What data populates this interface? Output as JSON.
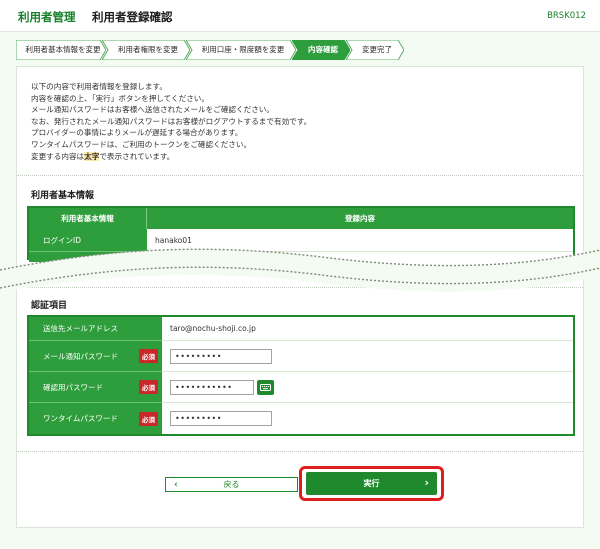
{
  "header": {
    "title": "利用者管理",
    "subtitle": "利用者登録確認",
    "screen_code": "BRSK012"
  },
  "steps": [
    {
      "label": "利用者基本情報を変更",
      "active": false
    },
    {
      "label": "利用者権限を変更",
      "active": false
    },
    {
      "label": "利用口座・限度額を変更",
      "active": false
    },
    {
      "label": "内容確認",
      "active": true
    },
    {
      "label": "変更完了",
      "active": false
    }
  ],
  "intro": {
    "line1": "以下の内容で利用者情報を登録します。",
    "line2": "内容を確認の上、「実行」ボタンを押してください。",
    "line3": "メール通知パスワードはお客様へ送信されたメールをご確認ください。",
    "line4": "なお、発行されたメール通知パスワードはお客様がログアウトするまで有効です。",
    "line5": "プロバイダーの事情によりメールが遅延する場合があります。",
    "line6": "ワンタイムパスワードは、ご利用のトークンをご確認ください。",
    "line7_pre": "変更する内容は",
    "line7_hl": "太字",
    "line7_post": "で表示されています。"
  },
  "basic": {
    "section_title": "利用者基本情報",
    "col1": "利用者基本情報",
    "col2": "登録内容",
    "rows": [
      {
        "label": "ログインID",
        "value": "hanako01"
      }
    ]
  },
  "auth": {
    "section_title": "認証項目",
    "rows": [
      {
        "label": "送信先メールアドレス",
        "value": "taro@nochu-shoji.co.jp"
      },
      {
        "label": "メール通知パスワード",
        "badge": "必須",
        "value": "•••••••••"
      },
      {
        "label": "確認用パスワード",
        "badge": "必須",
        "value": "•••••••••••"
      },
      {
        "label": "ワンタイムパスワード",
        "badge": "必須",
        "value": "•••••••••"
      }
    ]
  },
  "buttons": {
    "back": "戻る",
    "execute": "実行"
  },
  "colors": {
    "brand_green": "#1e8a2d",
    "header_green": "#2e9e3c",
    "required_red": "#c9282a",
    "highlight_border": "#e01d1d"
  }
}
